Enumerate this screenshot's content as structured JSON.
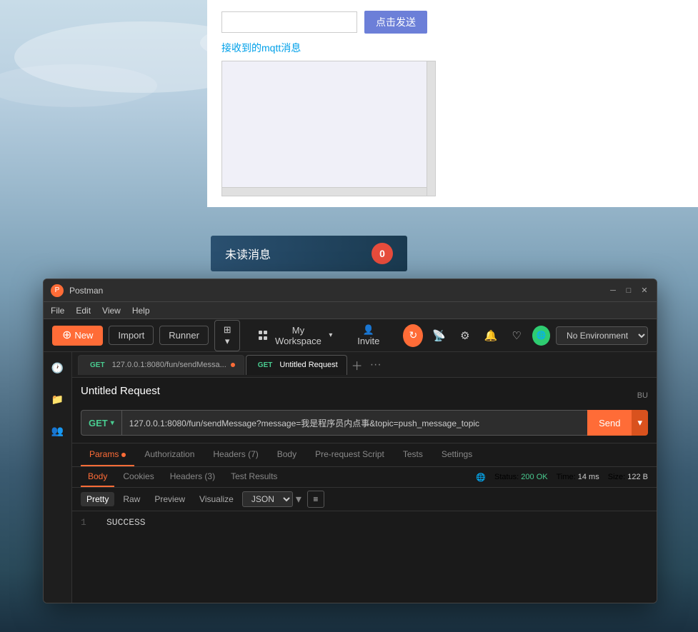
{
  "background": {
    "gradient": "sky to mountains"
  },
  "webapp": {
    "send_label": "点击发送",
    "mqtt_label": "接收到的mqtt消息",
    "unread_label": "未读消息",
    "unread_count": "0"
  },
  "postman": {
    "title": "Postman",
    "titlebar": {
      "minimize": "─",
      "maximize": "□",
      "close": "✕"
    },
    "menu": {
      "file": "File",
      "edit": "Edit",
      "view": "View",
      "help": "Help"
    },
    "toolbar": {
      "new_label": "New",
      "import_label": "Import",
      "runner_label": "Runner",
      "workspace_label": "My Workspace",
      "invite_label": "Invite"
    },
    "env": {
      "label": "No Environment"
    },
    "tabs": [
      {
        "method": "GET",
        "title": "127.0.0.1:8080/fun/sendMessa...",
        "active": false
      },
      {
        "method": "GET",
        "title": "Untitled Request",
        "active": true
      }
    ],
    "request": {
      "title": "Untitled Request",
      "save_label": "BU",
      "method": "GET",
      "url": "127.0.0.1:8080/fun/sendMessage?message=我是程序员内点事&topic=push_message_topic",
      "send_label": "Send"
    },
    "nav_tabs": [
      {
        "label": "Params",
        "active": false,
        "dot": true
      },
      {
        "label": "Authorization",
        "active": false
      },
      {
        "label": "Headers (7)",
        "active": false
      },
      {
        "label": "Body",
        "active": false
      },
      {
        "label": "Pre-request Script",
        "active": false
      },
      {
        "label": "Tests",
        "active": false
      },
      {
        "label": "Settings",
        "active": false
      }
    ],
    "response_tabs": [
      {
        "label": "Body",
        "active": true
      },
      {
        "label": "Cookies",
        "active": false
      },
      {
        "label": "Headers (3)",
        "active": false
      },
      {
        "label": "Test Results",
        "active": false
      }
    ],
    "response_status": {
      "status_label": "Status:",
      "status_value": "200 OK",
      "time_label": "Time:",
      "time_value": "14 ms",
      "size_label": "Size:",
      "size_value": "122 B"
    },
    "format_buttons": [
      {
        "label": "Pretty",
        "active": true
      },
      {
        "label": "Raw",
        "active": false
      },
      {
        "label": "Preview",
        "active": false
      },
      {
        "label": "Visualize",
        "active": false
      }
    ],
    "format_select": "JSON",
    "response_body": [
      {
        "line": "1",
        "content": "SUCCESS"
      }
    ]
  }
}
